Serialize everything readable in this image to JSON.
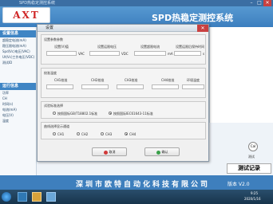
{
  "window": {
    "titlebar_text": "SPD热稳定测控系统"
  },
  "app": {
    "logo": "AXT",
    "title": "SPD热稳定测控系统"
  },
  "sidebar": {
    "settings_header": "设置信息",
    "settings_items": [
      "超稳定电流(mA)",
      "稳压限电流(mA)",
      "Spd(Vc)电压(VAC)",
      "Ut(Vc)工作电压(VDC)",
      "测试ID"
    ],
    "run_header": "运行信息",
    "run_items": [
      "功率",
      "CH",
      "时间(s)",
      "电流(mA)",
      "电压(V)",
      "温度"
    ]
  },
  "dialog": {
    "title": "设置",
    "close": "✕",
    "params": {
      "header": "设置参数参数",
      "fields": [
        {
          "label": "设置(V)值",
          "unit": "VAC"
        },
        {
          "label": "设置运限电压",
          "unit": "VDC"
        },
        {
          "label": "设置超限电流",
          "unit": "mA"
        },
        {
          "label": "设置运限后保持时间",
          "unit": "s"
        }
      ]
    },
    "temp": {
      "header": "校准温度",
      "fields": [
        "CH1校准",
        "CH2校准",
        "CH3校准",
        "CH4校准",
        "环境温度"
      ]
    },
    "standard": {
      "header": "试验标准选择",
      "options": [
        "按照国标GB/T18802.1标准",
        "按照国际IEC61643-11标准"
      ],
      "selected": 1
    },
    "channel": {
      "header": "曲线选择显示通道",
      "options": [
        "CH1",
        "CH2",
        "CH3",
        "CH4"
      ],
      "selected": 3
    },
    "buttons": {
      "cancel": "取消",
      "confirm": "确认"
    }
  },
  "right": {
    "knob1": "Cal",
    "knob2": "测试",
    "record_btn": "测试记录"
  },
  "footer": {
    "company": "深圳市欧特自动化科技有限公司",
    "version": "版本 V2.0"
  },
  "taskbar": {
    "time": "9:25",
    "date": "2020/1/16"
  }
}
